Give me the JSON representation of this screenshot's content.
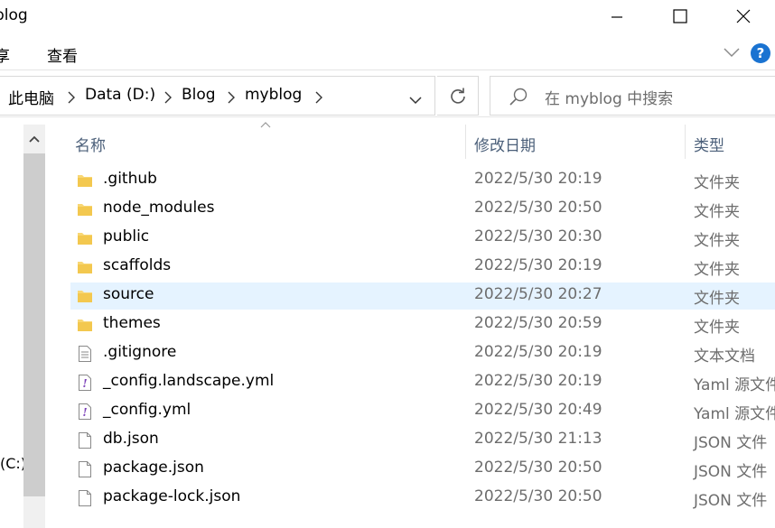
{
  "window": {
    "title": "blog",
    "minimize_icon": "minimize-icon",
    "maximize_icon": "maximize-icon",
    "close_icon": "close-icon"
  },
  "ribbon": {
    "tabs": [
      {
        "label": "享"
      },
      {
        "label": "查看"
      }
    ],
    "expand_icon": "chevron-down-icon",
    "help_label": "?"
  },
  "address": {
    "crumbs": [
      {
        "label": "此电脑"
      },
      {
        "label": "Data (D:)"
      },
      {
        "label": "Blog"
      },
      {
        "label": "myblog"
      }
    ],
    "separator_icon": "chevron-right-icon",
    "dropdown_icon": "chevron-down-icon",
    "refresh_icon": "refresh-icon"
  },
  "search": {
    "placeholder": "在 myblog 中搜索",
    "icon": "search-icon"
  },
  "navpane": {
    "drive_label": "(C:)",
    "scroll_up_icon": "chevron-up-icon"
  },
  "columns": {
    "name": "名称",
    "modified": "修改日期",
    "type": "类型"
  },
  "files": [
    {
      "name": ".github",
      "modified": "2022/5/30 20:19",
      "type": "文件夹",
      "icon": "folder-icon",
      "selected": false
    },
    {
      "name": "node_modules",
      "modified": "2022/5/30 20:50",
      "type": "文件夹",
      "icon": "folder-icon",
      "selected": false
    },
    {
      "name": "public",
      "modified": "2022/5/30 20:30",
      "type": "文件夹",
      "icon": "folder-icon",
      "selected": false
    },
    {
      "name": "scaffolds",
      "modified": "2022/5/30 20:19",
      "type": "文件夹",
      "icon": "folder-icon",
      "selected": false
    },
    {
      "name": "source",
      "modified": "2022/5/30 20:27",
      "type": "文件夹",
      "icon": "folder-icon",
      "selected": true
    },
    {
      "name": "themes",
      "modified": "2022/5/30 20:59",
      "type": "文件夹",
      "icon": "folder-icon",
      "selected": false
    },
    {
      "name": ".gitignore",
      "modified": "2022/5/30 20:19",
      "type": "文本文档",
      "icon": "text-file-icon",
      "selected": false
    },
    {
      "name": "_config.landscape.yml",
      "modified": "2022/5/30 20:19",
      "type": "Yaml 源文件",
      "icon": "yaml-file-icon",
      "selected": false
    },
    {
      "name": "_config.yml",
      "modified": "2022/5/30 20:49",
      "type": "Yaml 源文件",
      "icon": "yaml-file-icon",
      "selected": false
    },
    {
      "name": "db.json",
      "modified": "2022/5/30 21:13",
      "type": "JSON 文件",
      "icon": "blank-file-icon",
      "selected": false
    },
    {
      "name": "package.json",
      "modified": "2022/5/30 20:50",
      "type": "JSON 文件",
      "icon": "blank-file-icon",
      "selected": false
    },
    {
      "name": "package-lock.json",
      "modified": "2022/5/30 20:50",
      "type": "JSON 文件",
      "icon": "blank-file-icon",
      "selected": false
    }
  ],
  "colors": {
    "selection": "#e5f3ff",
    "folder": "#f8d775",
    "yaml_accent": "#7a3fb8",
    "help_blue": "#1a73d1"
  }
}
